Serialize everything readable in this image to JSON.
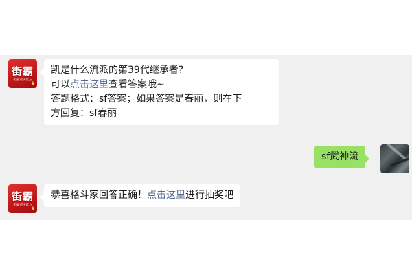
{
  "colors": {
    "chat_background": "#f0f0f0",
    "incoming_bubble": "#ffffff",
    "outgoing_bubble": "#98e165",
    "link": "#576b95",
    "brand_red": "#d0201f"
  },
  "messages": [
    {
      "sender": "official-account",
      "avatar": {
        "icon": "brand-logo-icon",
        "brand_text": "街霸",
        "brand_sub": "街霸对决官方",
        "badge_icon": "star-icon"
      },
      "lines": {
        "line1": "凯是什么流派的第39代继承者?",
        "line2_prefix": "可以",
        "line2_link": "点击这里",
        "line2_suffix": "查看答案哦~",
        "line3": "答题格式：sf答案；如果答案是春丽，则在下",
        "line4": "方回复：sf春丽"
      }
    },
    {
      "sender": "user",
      "avatar": {
        "icon": "user-avatar-photo"
      },
      "text": "sf武神流"
    },
    {
      "sender": "official-account",
      "avatar": {
        "icon": "brand-logo-icon",
        "brand_text": "街霸",
        "brand_sub": "街霸对决官方",
        "badge_icon": "star-icon"
      },
      "lines": {
        "prefix": "恭喜格斗家回答正确！",
        "link": "点击这里",
        "suffix": "进行抽奖吧"
      }
    }
  ]
}
